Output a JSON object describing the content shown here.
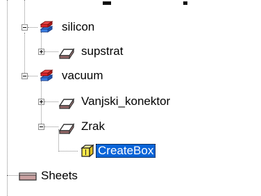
{
  "tree": {
    "nodes": [
      {
        "id": "silicon",
        "label": "silicon",
        "expanded": true,
        "icon": "material-icon"
      },
      {
        "id": "supstrat",
        "label": "supstrat",
        "expanded": false,
        "icon": "solid-icon"
      },
      {
        "id": "vacuum",
        "label": "vacuum",
        "expanded": true,
        "icon": "material-icon"
      },
      {
        "id": "vanjski",
        "label": "Vanjski_konektor",
        "expanded": false,
        "icon": "solid-icon"
      },
      {
        "id": "zrak",
        "label": "Zrak",
        "expanded": true,
        "icon": "solid-icon"
      },
      {
        "id": "createbox",
        "label": "CreateBox",
        "selected": true,
        "icon": "create-operation-icon"
      },
      {
        "id": "sheets",
        "label": "Sheets",
        "icon": "sheet-folder-icon"
      }
    ],
    "colors": {
      "selection": "#0a64d8",
      "material_red": "#e0242a",
      "material_blue": "#2f74d8"
    }
  }
}
